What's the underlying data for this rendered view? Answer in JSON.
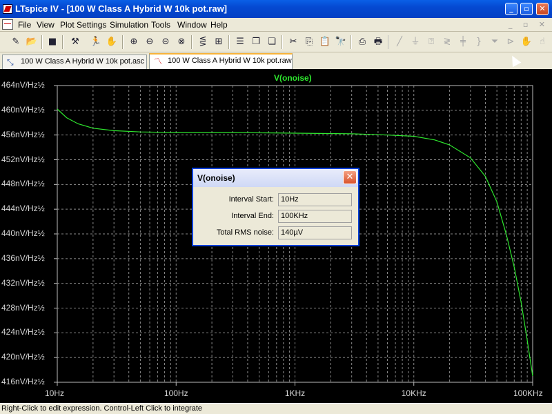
{
  "window": {
    "title": "LTspice IV - [100 W Class A Hybrid W 10k pot.raw]",
    "controls": {
      "minimize": "_",
      "restore": "▫",
      "close": "✕"
    }
  },
  "menubar": {
    "items": [
      "File",
      "View",
      "Plot Settings",
      "Simulation",
      "Tools",
      "Window",
      "Help"
    ],
    "mdi_controls": "_ ▫ ✕"
  },
  "toolbar": {
    "icons": [
      "new-schematic-icon",
      "open-icon",
      "save-icon",
      "control-panel-icon",
      "run-icon",
      "halt-icon",
      "zoom-in-icon",
      "zoom-out-icon",
      "zoom-back-icon",
      "zoom-cancel-icon",
      "autorange-icon",
      "fit-icon",
      "tile-horizontal-icon",
      "cascade-icon",
      "tile-vertical-icon",
      "cut-icon",
      "copy-icon",
      "paste-icon",
      "find-icon",
      "print-preview-icon",
      "print-icon",
      "wire-icon",
      "ground-icon",
      "label-icon",
      "resistor-icon",
      "capacitor-icon",
      "inductor-icon",
      "diode-icon",
      "component-icon",
      "move-icon",
      "drag-icon"
    ]
  },
  "tabs": [
    {
      "label": "100 W Class A Hybrid W 10k pot.asc",
      "icon": "schematic-icon",
      "active": false
    },
    {
      "label": "100 W Class A Hybrid W 10k pot.raw",
      "icon": "waveform-icon",
      "active": true
    }
  ],
  "chart_data": {
    "type": "line",
    "title": "V(onoise)",
    "x_scale": "log",
    "xlim": [
      10,
      100000
    ],
    "ylim": [
      416,
      464
    ],
    "x_ticks": [
      {
        "value": 10,
        "label": "10Hz"
      },
      {
        "value": 100,
        "label": "100Hz"
      },
      {
        "value": 1000,
        "label": "1KHz"
      },
      {
        "value": 10000,
        "label": "10KHz"
      },
      {
        "value": 100000,
        "label": "100KHz"
      }
    ],
    "y_ticks": [
      {
        "value": 464,
        "label": "464nV/Hz½"
      },
      {
        "value": 460,
        "label": "460nV/Hz½"
      },
      {
        "value": 456,
        "label": "456nV/Hz½"
      },
      {
        "value": 452,
        "label": "452nV/Hz½"
      },
      {
        "value": 448,
        "label": "448nV/Hz½"
      },
      {
        "value": 444,
        "label": "444nV/Hz½"
      },
      {
        "value": 440,
        "label": "440nV/Hz½"
      },
      {
        "value": 436,
        "label": "436nV/Hz½"
      },
      {
        "value": 432,
        "label": "432nV/Hz½"
      },
      {
        "value": 428,
        "label": "428nV/Hz½"
      },
      {
        "value": 424,
        "label": "424nV/Hz½"
      },
      {
        "value": 420,
        "label": "420nV/Hz½"
      },
      {
        "value": 416,
        "label": "416nV/Hz½"
      }
    ],
    "grid": true,
    "series_color": "#2ee62e",
    "series": [
      {
        "x": [
          10,
          12,
          15,
          20,
          30,
          50,
          100,
          300,
          1000,
          3000,
          6000,
          10000,
          15000,
          20000,
          30000,
          40000,
          50000,
          60000,
          70000,
          80000,
          90000,
          100000
        ],
        "y": [
          460.2,
          458.8,
          457.8,
          457.1,
          456.7,
          456.5,
          456.4,
          456.4,
          456.3,
          456.2,
          456.0,
          455.8,
          455.2,
          454.4,
          452.3,
          449.3,
          445.2,
          439.9,
          434.6,
          428.9,
          422.8,
          417.0
        ]
      }
    ]
  },
  "dialog": {
    "title": "V(onoise)",
    "close": "✕",
    "rows": [
      {
        "label": "Interval Start:",
        "value": "10Hz"
      },
      {
        "label": "Interval End:",
        "value": "100KHz"
      },
      {
        "label": "Total RMS noise:",
        "value": "140µV"
      }
    ]
  },
  "statusbar": {
    "text": "Right-Click to edit expression. Control-Left Click to integrate"
  }
}
